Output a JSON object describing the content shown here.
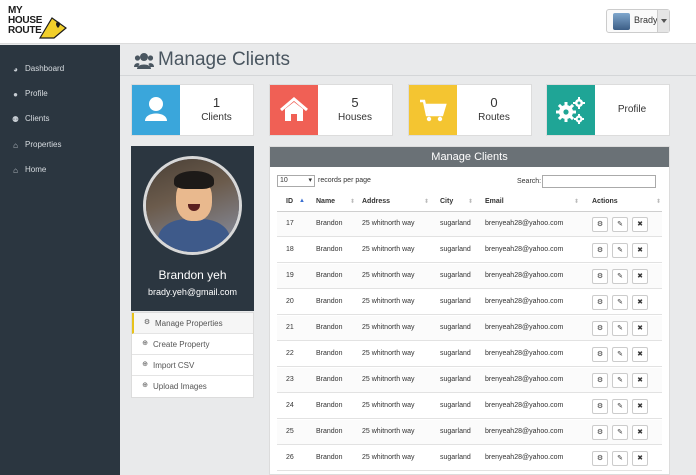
{
  "header": {
    "logo_lines": [
      "MY",
      "HOUSE",
      "ROUTE"
    ],
    "user_name": "Brady"
  },
  "sidebar": {
    "items": [
      {
        "label": "Dashboard",
        "icon": "dashboard-icon"
      },
      {
        "label": "Profile",
        "icon": "user-icon"
      },
      {
        "label": "Clients",
        "icon": "users-icon"
      },
      {
        "label": "Properties",
        "icon": "home-icon"
      },
      {
        "label": "Home",
        "icon": "home-icon"
      }
    ]
  },
  "page": {
    "title": "Manage Clients",
    "title_icon": "users-icon"
  },
  "stats": [
    {
      "value": "1",
      "label": "Clients",
      "icon": "user-icon",
      "color": "#3aa6db"
    },
    {
      "value": "5",
      "label": "Houses",
      "icon": "house-icon",
      "color": "#f06055"
    },
    {
      "value": "0",
      "label": "Routes",
      "icon": "cart-icon",
      "color": "#f4c531"
    },
    {
      "value": "",
      "label": "Profile",
      "icon": "gears-icon",
      "color": "#1fa596"
    }
  ],
  "profile": {
    "name": "Brandon yeh",
    "email": "brady.yeh@gmail.com",
    "menu": [
      {
        "label": "Manage Properties",
        "icon": "settings-icon"
      },
      {
        "label": "Create Property",
        "icon": "plus-circle-icon"
      },
      {
        "label": "Import CSV",
        "icon": "plus-circle-icon"
      },
      {
        "label": "Upload Images",
        "icon": "plus-circle-icon"
      }
    ]
  },
  "table": {
    "title": "Manage Clients",
    "records_per_page": "10",
    "records_label": "records per page",
    "search_label": "Search:",
    "columns": [
      "ID",
      "Name",
      "Address",
      "City",
      "Email",
      "Actions"
    ],
    "rows": [
      {
        "id": "17",
        "name": "Brandon",
        "address": "25 whitnorth way",
        "city": "sugarland",
        "email": "brenyeah28@yahoo.com"
      },
      {
        "id": "18",
        "name": "Brandon",
        "address": "25 whitnorth way",
        "city": "sugarland",
        "email": "brenyeah28@yahoo.com"
      },
      {
        "id": "19",
        "name": "Brandon",
        "address": "25 whitnorth way",
        "city": "sugarland",
        "email": "brenyeah28@yahoo.com"
      },
      {
        "id": "20",
        "name": "Brandon",
        "address": "25 whitnorth way",
        "city": "sugarland",
        "email": "brenyeah28@yahoo.com"
      },
      {
        "id": "21",
        "name": "Brandon",
        "address": "25 whitnorth way",
        "city": "sugarland",
        "email": "brenyeah28@yahoo.com"
      },
      {
        "id": "22",
        "name": "Brandon",
        "address": "25 whitnorth way",
        "city": "sugarland",
        "email": "brenyeah28@yahoo.com"
      },
      {
        "id": "23",
        "name": "Brandon",
        "address": "25 whitnorth way",
        "city": "sugarland",
        "email": "brenyeah28@yahoo.com"
      },
      {
        "id": "24",
        "name": "Brandon",
        "address": "25 whitnorth way",
        "city": "sugarland",
        "email": "brenyeah28@yahoo.com"
      },
      {
        "id": "25",
        "name": "Brandon",
        "address": "25 whitnorth way",
        "city": "sugarland",
        "email": "brenyeah28@yahoo.com"
      },
      {
        "id": "26",
        "name": "Brandon",
        "address": "25 whitnorth way",
        "city": "sugarland",
        "email": "brenyeah28@yahoo.com"
      }
    ],
    "actions": [
      {
        "icon": "gear-icon",
        "glyph": "⚙"
      },
      {
        "icon": "pencil-icon",
        "glyph": "✎"
      },
      {
        "icon": "close-icon",
        "glyph": "✖"
      }
    ]
  }
}
